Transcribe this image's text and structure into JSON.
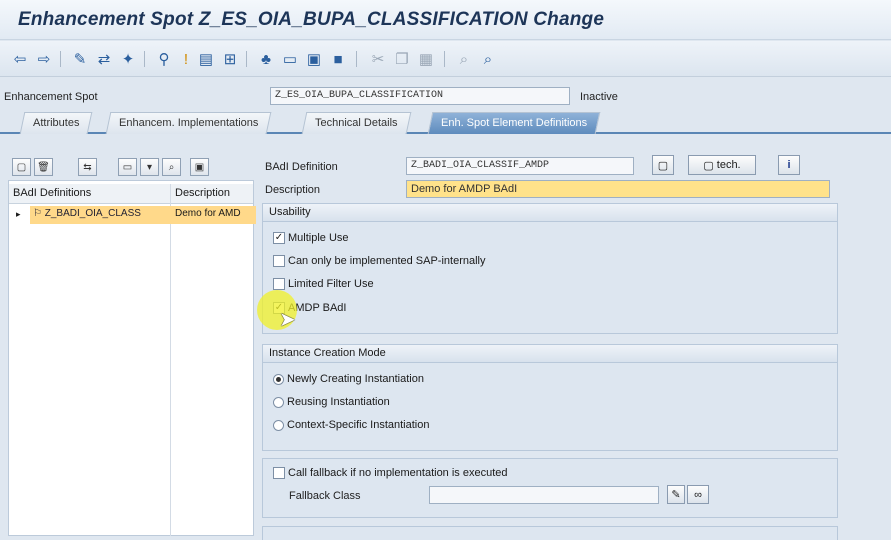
{
  "window": {
    "title": "Enhancement Spot Z_ES_OIA_BUPA_CLASSIFICATION Change"
  },
  "toolbar": {
    "icons": [
      "back-arrow-icon",
      "forward-arrow-icon",
      "display-change-icon",
      "other-object-icon",
      "activate-icon",
      "where-used-icon",
      "inactive-icon",
      "check-icon",
      "hierarchy-icon",
      "layout-icon",
      "screen-icon",
      "info-icon",
      "cut-icon",
      "copy-icon",
      "paste-icon",
      "find-icon",
      "find-next-icon"
    ]
  },
  "header": {
    "spot_label": "Enhancement Spot",
    "spot_value": "Z_ES_OIA_BUPA_CLASSIFICATION",
    "status": "Inactive"
  },
  "tabs": [
    {
      "label": "Attributes",
      "active": false
    },
    {
      "label": "Enhancem. Implementations",
      "active": false
    },
    {
      "label": "Technical Details",
      "active": false
    },
    {
      "label": "Enh. Spot Element Definitions",
      "active": true
    }
  ],
  "tree": {
    "col1": "BAdI Definitions",
    "col2": "Description",
    "rows": [
      {
        "name": "Z_BADI_OIA_CLASS",
        "description": "Demo for AMD"
      }
    ]
  },
  "badi": {
    "def_label": "BAdI Definition",
    "def_value": "Z_BADI_OIA_CLASSIF_AMDP",
    "desc_label": "Description",
    "desc_value": "Demo for AMDP BAdI",
    "tech_label": "tech."
  },
  "usability": {
    "title": "Usability",
    "items": [
      {
        "label": "Multiple Use",
        "checked": true
      },
      {
        "label": "Can only be implemented SAP-internally",
        "checked": false
      },
      {
        "label": "Limited Filter Use",
        "checked": false
      },
      {
        "label": "AMDP BAdI",
        "checked": true
      }
    ]
  },
  "instance": {
    "title": "Instance Creation Mode",
    "options": [
      {
        "label": "Newly Creating Instantiation",
        "selected": true
      },
      {
        "label": "Reusing Instantiation",
        "selected": false
      },
      {
        "label": "Context-Specific Instantiation",
        "selected": false
      }
    ]
  },
  "fallback": {
    "checkbox_label": "Call fallback if no implementation is executed",
    "checked": false,
    "class_label": "Fallback Class",
    "class_value": ""
  },
  "colors": {
    "accent": "#5e8bbd",
    "highlight": "#ffd98a",
    "title": "#1d3558"
  }
}
